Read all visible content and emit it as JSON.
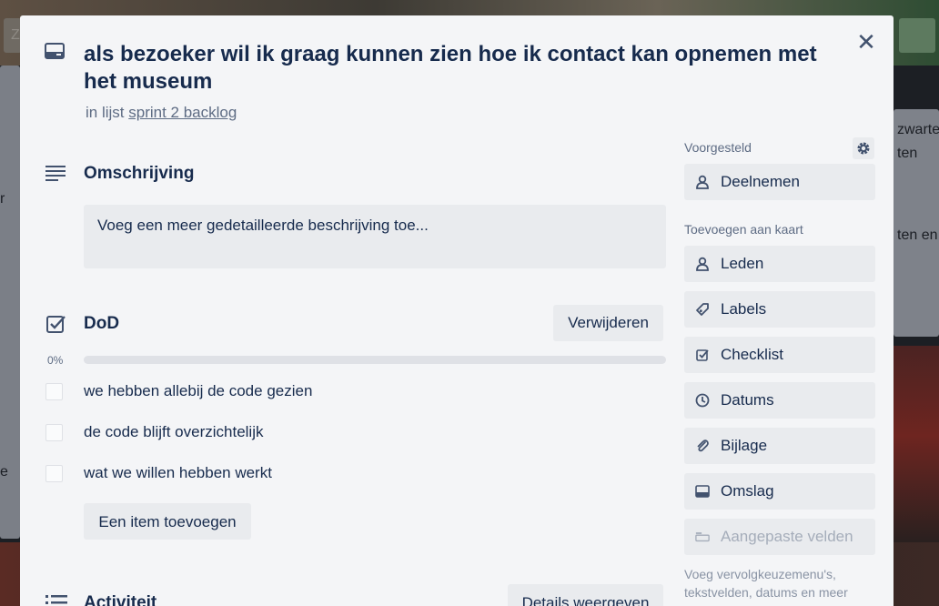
{
  "card": {
    "title": "als bezoeker wil ik graag kunnen zien hoe ik contact kan opnemen met het museum",
    "in_list_prefix": "in lijst",
    "list_name": "sprint 2 backlog"
  },
  "description": {
    "heading": "Omschrijving",
    "placeholder": "Voeg een meer gedetailleerde beschrijving toe..."
  },
  "checklist": {
    "heading": "DoD",
    "delete_label": "Verwijderen",
    "percent_label": "0%",
    "progress": 0,
    "items": [
      {
        "label": "we hebben allebij de code gezien",
        "checked": false
      },
      {
        "label": "de code blijft overzichtelijk",
        "checked": false
      },
      {
        "label": "wat we willen hebben werkt",
        "checked": false
      }
    ],
    "add_item_label": "Een item toevoegen"
  },
  "activity": {
    "heading": "Activiteit",
    "details_label": "Details weergeven"
  },
  "sidebar": {
    "suggested_heading": "Voorgesteld",
    "join_label": "Deelnemen",
    "add_to_card_heading": "Toevoegen aan kaart",
    "buttons": [
      {
        "label": "Leden",
        "icon": "person-icon"
      },
      {
        "label": "Labels",
        "icon": "tag-icon"
      },
      {
        "label": "Checklist",
        "icon": "checklist-icon"
      },
      {
        "label": "Datums",
        "icon": "clock-icon"
      },
      {
        "label": "Bijlage",
        "icon": "paperclip-icon"
      },
      {
        "label": "Omslag",
        "icon": "card-cover-icon"
      },
      {
        "label": "Aangepaste velden",
        "icon": "custom-fields-icon",
        "disabled": true
      }
    ],
    "note": "Voeg vervolgkeuzemenu's, tekstvelden, datums en meer"
  },
  "background": {
    "left_text_1": "Z",
    "left_text_2": "r",
    "left_text_3": "e",
    "right_text_1": "zwarte",
    "right_text_2": "ten",
    "right_text_3": "ten en"
  },
  "colors": {
    "modal_bg": "#f4f5f7",
    "button_bg": "#e9ebee",
    "text": "#172b4d",
    "muted": "#5e6c84",
    "progress_track": "#dfe1e6"
  }
}
